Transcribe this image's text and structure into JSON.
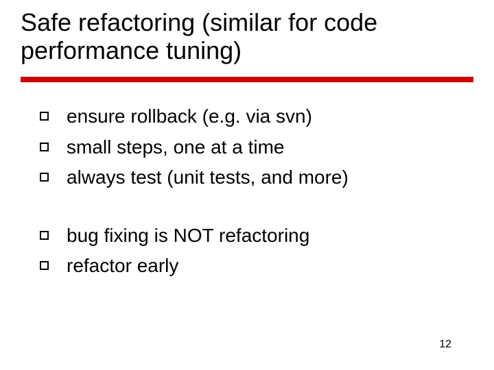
{
  "title": "Safe refactoring (similar for code performance tuning)",
  "bullets_a": [
    "ensure rollback (e.g. via svn)",
    "small steps, one at a time",
    "always test (unit tests, and more)"
  ],
  "bullets_b": [
    "bug fixing is NOT refactoring",
    "refactor early"
  ],
  "page_number": "12"
}
